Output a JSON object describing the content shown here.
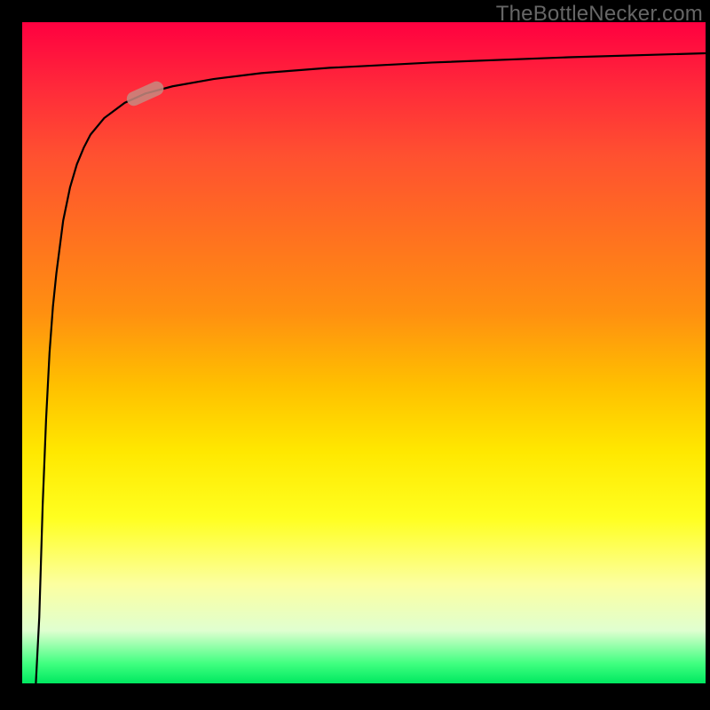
{
  "attribution": "TheBottleNecker.com",
  "chart_data": {
    "type": "line",
    "title": "",
    "xlabel": "",
    "ylabel": "",
    "x_range": [
      0,
      100
    ],
    "y_range": [
      0,
      100
    ],
    "background_gradient": {
      "orientation": "vertical",
      "stops": [
        {
          "pos": 0,
          "color": "#ff0040"
        },
        {
          "pos": 50,
          "color": "#ffc800"
        },
        {
          "pos": 75,
          "color": "#ffff20"
        },
        {
          "pos": 100,
          "color": "#00e860"
        }
      ]
    },
    "series": [
      {
        "name": "curve",
        "x": [
          2.0,
          2.5,
          3.0,
          3.5,
          4.0,
          4.5,
          5.0,
          6.0,
          7.0,
          8.0,
          9.0,
          10.0,
          12.0,
          15.0,
          18.0,
          22.0,
          28.0,
          35.0,
          45.0,
          60.0,
          80.0,
          100.0
        ],
        "y": [
          0.0,
          10.0,
          27.0,
          40.0,
          50.0,
          57.0,
          62.0,
          70.0,
          75.0,
          78.5,
          81.0,
          83.0,
          85.5,
          87.8,
          89.2,
          90.3,
          91.4,
          92.3,
          93.1,
          93.9,
          94.7,
          95.3
        ]
      }
    ],
    "marker": {
      "series": "curve",
      "x": 18.0,
      "y": 89.2,
      "shape": "pill",
      "color": "#c78a80"
    }
  }
}
